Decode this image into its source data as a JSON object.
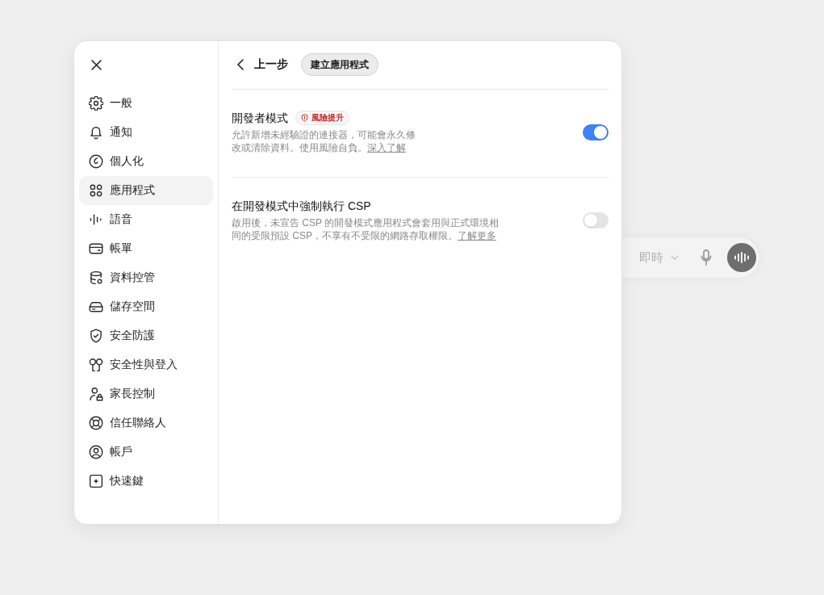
{
  "composer": {
    "mode": "即時"
  },
  "sidebar": {
    "items": [
      {
        "label": "一般",
        "selected": false
      },
      {
        "label": "通知",
        "selected": false
      },
      {
        "label": "個人化",
        "selected": false
      },
      {
        "label": "應用程式",
        "selected": true
      },
      {
        "label": "語音",
        "selected": false
      },
      {
        "label": "帳單",
        "selected": false
      },
      {
        "label": "資料控管",
        "selected": false
      },
      {
        "label": "儲存空間",
        "selected": false
      },
      {
        "label": "安全防護",
        "selected": false
      },
      {
        "label": "安全性與登入",
        "selected": false
      },
      {
        "label": "家長控制",
        "selected": false
      },
      {
        "label": "信任聯絡人",
        "selected": false
      },
      {
        "label": "帳戶",
        "selected": false
      },
      {
        "label": "快速鍵",
        "selected": false
      }
    ]
  },
  "header": {
    "back_label": "上一步",
    "current_page": "建立應用程式"
  },
  "settings": [
    {
      "title": "開發者模式",
      "badge": "風險提升",
      "description": "允許新增未經驗證的連接器，可能會永久修改或清除資料。使用風險自負。",
      "link": "深入了解",
      "on": true
    },
    {
      "title": "在開發模式中強制執行 CSP",
      "description": "啟用後，未宣告 CSP 的開發模式應用程式會套用與正式環境相同的受限預設 CSP，不享有不受限的網路存取權限。",
      "link": "了解更多",
      "on": false
    }
  ]
}
